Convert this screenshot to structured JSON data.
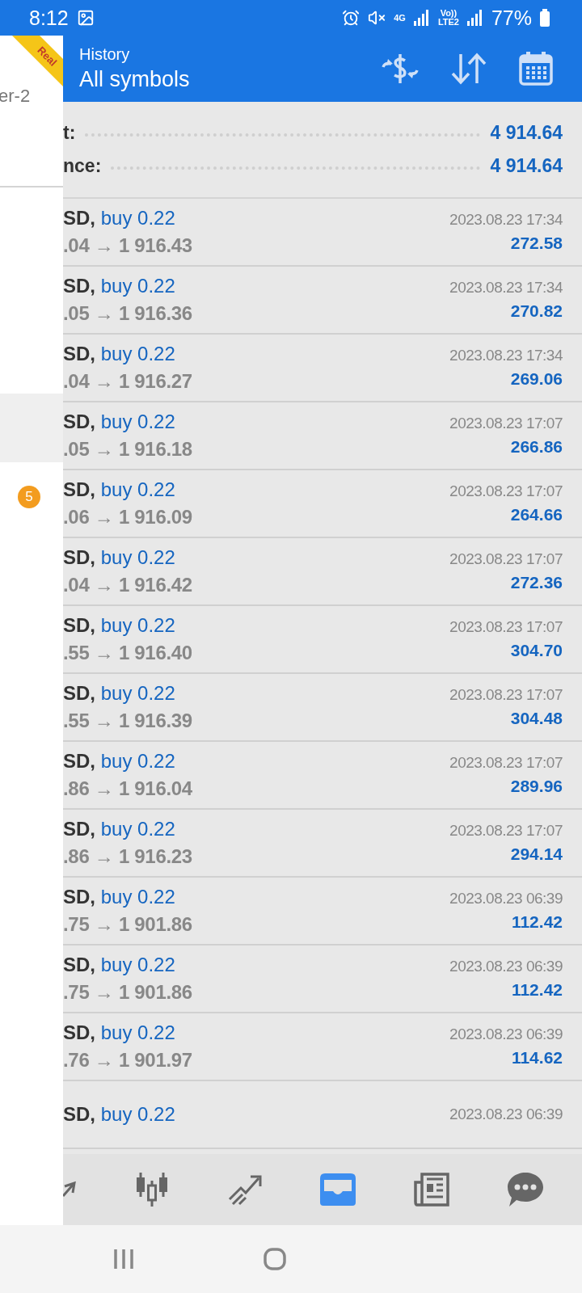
{
  "status_bar": {
    "time": "8:12",
    "network": "4G",
    "volte_top": "Vo))",
    "volte_bottom": "LTE2",
    "battery": "77%"
  },
  "drawer": {
    "ribbon": "Real",
    "account_fragment": "er-2",
    "badge": "5"
  },
  "header": {
    "title": "History",
    "subtitle": "All symbols"
  },
  "summary": [
    {
      "label": "t:",
      "value": "4 914.64"
    },
    {
      "label": "nce:",
      "value": "4 914.64"
    }
  ],
  "deals": [
    {
      "symbol": "SD,",
      "side": "buy 0.22",
      "prices": ".04 → 1 916.43",
      "time": "2023.08.23 17:34",
      "profit": "272.58"
    },
    {
      "symbol": "SD,",
      "side": "buy 0.22",
      "prices": ".05 → 1 916.36",
      "time": "2023.08.23 17:34",
      "profit": "270.82"
    },
    {
      "symbol": "SD,",
      "side": "buy 0.22",
      "prices": ".04 → 1 916.27",
      "time": "2023.08.23 17:34",
      "profit": "269.06"
    },
    {
      "symbol": "SD,",
      "side": "buy 0.22",
      "prices": ".05 → 1 916.18",
      "time": "2023.08.23 17:07",
      "profit": "266.86"
    },
    {
      "symbol": "SD,",
      "side": "buy 0.22",
      "prices": ".06 → 1 916.09",
      "time": "2023.08.23 17:07",
      "profit": "264.66"
    },
    {
      "symbol": "SD,",
      "side": "buy 0.22",
      "prices": ".04 → 1 916.42",
      "time": "2023.08.23 17:07",
      "profit": "272.36"
    },
    {
      "symbol": "SD,",
      "side": "buy 0.22",
      "prices": ".55 → 1 916.40",
      "time": "2023.08.23 17:07",
      "profit": "304.70"
    },
    {
      "symbol": "SD,",
      "side": "buy 0.22",
      "prices": ".55 → 1 916.39",
      "time": "2023.08.23 17:07",
      "profit": "304.48"
    },
    {
      "symbol": "SD,",
      "side": "buy 0.22",
      "prices": ".86 → 1 916.04",
      "time": "2023.08.23 17:07",
      "profit": "289.96"
    },
    {
      "symbol": "SD,",
      "side": "buy 0.22",
      "prices": ".86 → 1 916.23",
      "time": "2023.08.23 17:07",
      "profit": "294.14"
    },
    {
      "symbol": "SD,",
      "side": "buy 0.22",
      "prices": ".75 → 1 901.86",
      "time": "2023.08.23 06:39",
      "profit": "112.42"
    },
    {
      "symbol": "SD,",
      "side": "buy 0.22",
      "prices": ".75 → 1 901.86",
      "time": "2023.08.23 06:39",
      "profit": "112.42"
    },
    {
      "symbol": "SD,",
      "side": "buy 0.22",
      "prices": ".76 → 1 901.97",
      "time": "2023.08.23 06:39",
      "profit": "114.62"
    },
    {
      "symbol": "SD,",
      "side": "buy 0.22",
      "time": "2023.08.23 06:39"
    }
  ],
  "bottom_nav": [
    {
      "kind": "quotes",
      "selected": false
    },
    {
      "kind": "chart",
      "selected": false
    },
    {
      "kind": "trade",
      "selected": false
    },
    {
      "kind": "history",
      "selected": true
    },
    {
      "kind": "news",
      "selected": false
    },
    {
      "kind": "chat",
      "selected": false
    }
  ]
}
